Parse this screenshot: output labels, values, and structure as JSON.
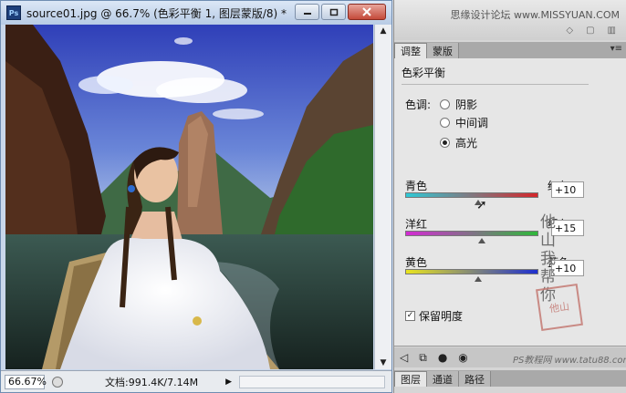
{
  "document": {
    "title": "source01.jpg @ 66.7% (色彩平衡 1, 图层蒙版/8) *",
    "app_icon": "Ps",
    "zoom": "66.67%",
    "doc_info": "文档:991.4K/7.14M"
  },
  "panel_top": {
    "watermark": "思缘设计论坛 www.MISSYUAN.COM"
  },
  "adjust_panel": {
    "tabs": [
      "调整",
      "蒙版"
    ],
    "title": "色彩平衡",
    "tone_label": "色调:",
    "tones": [
      "阴影",
      "中间调",
      "高光"
    ],
    "selected_tone": "高光",
    "sliders": [
      {
        "left": "青色",
        "right": "红色",
        "value": "+10",
        "level": 10
      },
      {
        "left": "洋红",
        "right": "绿色",
        "value": "+15",
        "level": 15
      },
      {
        "left": "黄色",
        "right": "蓝色",
        "value": "+10",
        "level": 10
      }
    ],
    "preserve_luminosity": "保留明度",
    "preserve_checked": true
  },
  "layers_tabs": [
    "图层",
    "通道",
    "路径"
  ],
  "watermarks": {
    "calligraphy": "他山我帮你",
    "seal": "他山",
    "bottom": "PS教程网 www.tatu88.com"
  },
  "colors": {
    "cyan_red": [
      "#2ec9d6",
      "#d5262a"
    ],
    "magenta_green": [
      "#d32bd3",
      "#2fb83a"
    ],
    "yellow_blue": [
      "#e9e41f",
      "#1e2fd0"
    ]
  },
  "icons": [
    "photoshop-icon",
    "minimize-icon",
    "restore-icon",
    "close-icon",
    "arrow-up-icon",
    "arrow-down-icon",
    "play-icon",
    "back-icon",
    "clip-icon",
    "visibility-icon",
    "eye-icon",
    "reset-icon",
    "trash-icon",
    "panel-menu-icon"
  ]
}
